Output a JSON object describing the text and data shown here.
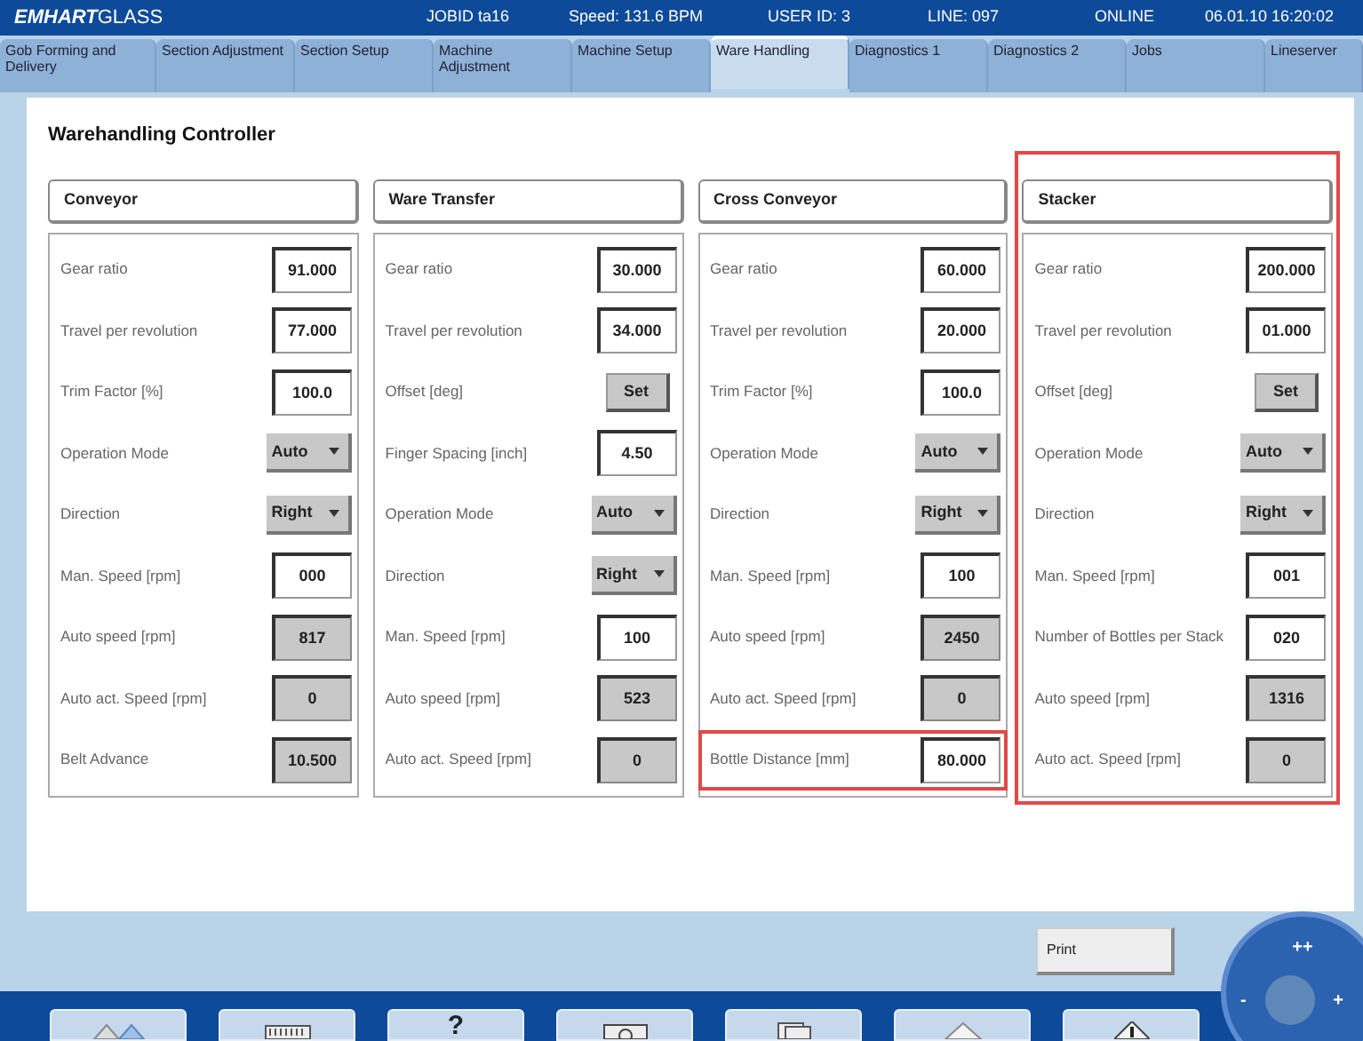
{
  "header": {
    "logo_bold": "EMHART",
    "logo_rest": "GLASS",
    "items": [
      "JOBID ta16",
      "Speed: 131.6 BPM",
      "USER ID: 3",
      "LINE: 097",
      "ONLINE",
      "06.01.10  16:20:02"
    ]
  },
  "tabs": [
    {
      "label": "Gob Forming and Delivery",
      "selected": false
    },
    {
      "label": "Section Adjustment",
      "selected": false
    },
    {
      "label": "Section Setup",
      "selected": false
    },
    {
      "label": "Machine Adjustment",
      "selected": false
    },
    {
      "label": "Machine Setup",
      "selected": false
    },
    {
      "label": "Ware Handling",
      "selected": true
    },
    {
      "label": "Diagnostics 1",
      "selected": false
    },
    {
      "label": "Diagnostics 2",
      "selected": false
    },
    {
      "label": "Jobs",
      "selected": false
    },
    {
      "label": "Lineserver",
      "selected": false
    }
  ],
  "page_title": "Warehandling Controller",
  "columns": [
    {
      "title": "Conveyor",
      "highlighted": false,
      "rows": [
        {
          "label": "Gear ratio",
          "kind": "input",
          "value": "91.000",
          "highlighted": false
        },
        {
          "label": "Travel per revolution",
          "kind": "input",
          "value": "77.000",
          "highlighted": false
        },
        {
          "label": "Trim Factor [%]",
          "kind": "input",
          "value": "100.0",
          "highlighted": false
        },
        {
          "label": "Operation Mode",
          "kind": "dropdown",
          "value": "Auto",
          "highlighted": false
        },
        {
          "label": "Direction",
          "kind": "dropdown",
          "value": "Right",
          "highlighted": false
        },
        {
          "label": "Man. Speed [rpm]",
          "kind": "input",
          "value": "000",
          "highlighted": false
        },
        {
          "label": "Auto speed [rpm]",
          "kind": "readonly",
          "value": "817",
          "highlighted": false
        },
        {
          "label": "Auto act. Speed [rpm]",
          "kind": "readonly",
          "value": "0",
          "highlighted": false
        },
        {
          "label": "Belt Advance",
          "kind": "readonly",
          "value": "10.500",
          "highlighted": false
        }
      ]
    },
    {
      "title": "Ware Transfer",
      "highlighted": false,
      "rows": [
        {
          "label": "Gear ratio",
          "kind": "input",
          "value": "30.000",
          "highlighted": false
        },
        {
          "label": "Travel per revolution",
          "kind": "input",
          "value": "34.000",
          "highlighted": false
        },
        {
          "label": "Offset [deg]",
          "kind": "button",
          "value": "Set",
          "highlighted": false
        },
        {
          "label": "Finger Spacing [inch]",
          "kind": "input",
          "value": "4.50",
          "highlighted": false
        },
        {
          "label": "Operation Mode",
          "kind": "dropdown",
          "value": "Auto",
          "highlighted": false
        },
        {
          "label": "Direction",
          "kind": "dropdown",
          "value": "Right",
          "highlighted": false
        },
        {
          "label": "Man. Speed [rpm]",
          "kind": "input",
          "value": "100",
          "highlighted": false
        },
        {
          "label": "Auto speed [rpm]",
          "kind": "readonly",
          "value": "523",
          "highlighted": false
        },
        {
          "label": "Auto act. Speed [rpm]",
          "kind": "readonly",
          "value": "0",
          "highlighted": false
        }
      ]
    },
    {
      "title": "Cross Conveyor",
      "highlighted": false,
      "rows": [
        {
          "label": "Gear ratio",
          "kind": "input",
          "value": "60.000",
          "highlighted": false
        },
        {
          "label": "Travel per revolution",
          "kind": "input",
          "value": "20.000",
          "highlighted": false
        },
        {
          "label": "Trim Factor [%]",
          "kind": "input",
          "value": "100.0",
          "highlighted": false
        },
        {
          "label": "Operation Mode",
          "kind": "dropdown",
          "value": "Auto",
          "highlighted": false
        },
        {
          "label": "Direction",
          "kind": "dropdown",
          "value": "Right",
          "highlighted": false
        },
        {
          "label": "Man. Speed [rpm]",
          "kind": "input",
          "value": "100",
          "highlighted": false
        },
        {
          "label": "Auto speed [rpm]",
          "kind": "readonly",
          "value": "2450",
          "highlighted": false
        },
        {
          "label": "Auto act. Speed [rpm]",
          "kind": "readonly",
          "value": "0",
          "highlighted": false
        },
        {
          "label": "Bottle Distance [mm]",
          "kind": "input",
          "value": "80.000",
          "highlighted": true
        }
      ]
    },
    {
      "title": "Stacker",
      "highlighted": true,
      "rows": [
        {
          "label": "Gear ratio",
          "kind": "input",
          "value": "200.000",
          "highlighted": false
        },
        {
          "label": "Travel per revolution",
          "kind": "input",
          "value": "01.000",
          "highlighted": false
        },
        {
          "label": "Offset [deg]",
          "kind": "button",
          "value": "Set",
          "highlighted": false
        },
        {
          "label": "Operation Mode",
          "kind": "dropdown",
          "value": "Auto",
          "highlighted": false
        },
        {
          "label": "Direction",
          "kind": "dropdown",
          "value": "Right",
          "highlighted": false
        },
        {
          "label": "Man. Speed [rpm]",
          "kind": "input",
          "value": "001",
          "highlighted": false
        },
        {
          "label": "Number of Bottles per Stack",
          "kind": "input",
          "value": "020",
          "highlighted": false
        },
        {
          "label": "Auto speed [rpm]",
          "kind": "readonly",
          "value": "1316",
          "highlighted": false
        },
        {
          "label": "Auto act. Speed [rpm]",
          "kind": "readonly",
          "value": "0",
          "highlighted": false
        }
      ]
    }
  ],
  "print_button": "Print",
  "toolbar": [
    {
      "kind": "arrows"
    },
    {
      "kind": "keyboard"
    },
    {
      "kind": "text",
      "label": "?"
    },
    {
      "kind": "camera"
    },
    {
      "kind": "document"
    },
    {
      "kind": "home"
    },
    {
      "kind": "warning"
    }
  ],
  "joystick": {
    "up": "++",
    "left": "-",
    "right": "+"
  }
}
